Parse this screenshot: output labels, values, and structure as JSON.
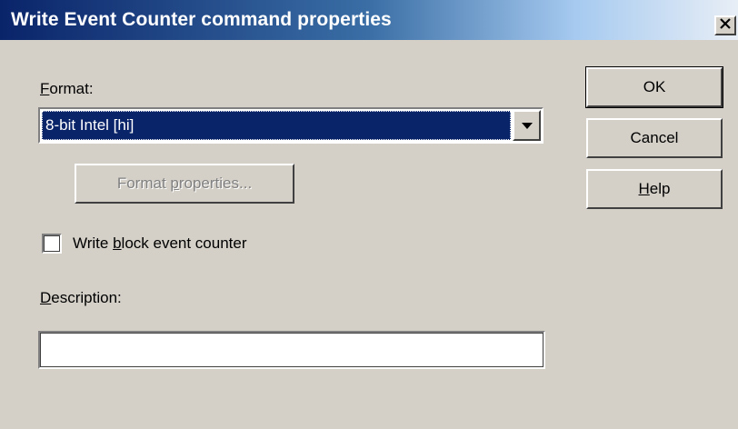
{
  "window": {
    "title": "Write Event Counter command properties",
    "close_glyph": "×"
  },
  "format": {
    "label_accel": "F",
    "label_rest": "ormat:",
    "selected": "8-bit Intel  [hi]",
    "properties_btn_pre": "Format ",
    "properties_btn_accel": "p",
    "properties_btn_post": "roperties..."
  },
  "checkbox": {
    "label_pre": "Write ",
    "label_accel": "b",
    "label_post": "lock event counter"
  },
  "description": {
    "label_accel": "D",
    "label_rest": "escription:",
    "value": ""
  },
  "buttons": {
    "ok": "OK",
    "cancel": "Cancel",
    "help_accel": "H",
    "help_rest": "elp"
  },
  "colors": {
    "face": "#d4d0c8",
    "title_start": "#0a246a",
    "title_end": "#a6caf0",
    "highlight": "#0a246a"
  },
  "icons": {
    "close": "close-icon",
    "dropdown": "chevron-down-icon"
  }
}
